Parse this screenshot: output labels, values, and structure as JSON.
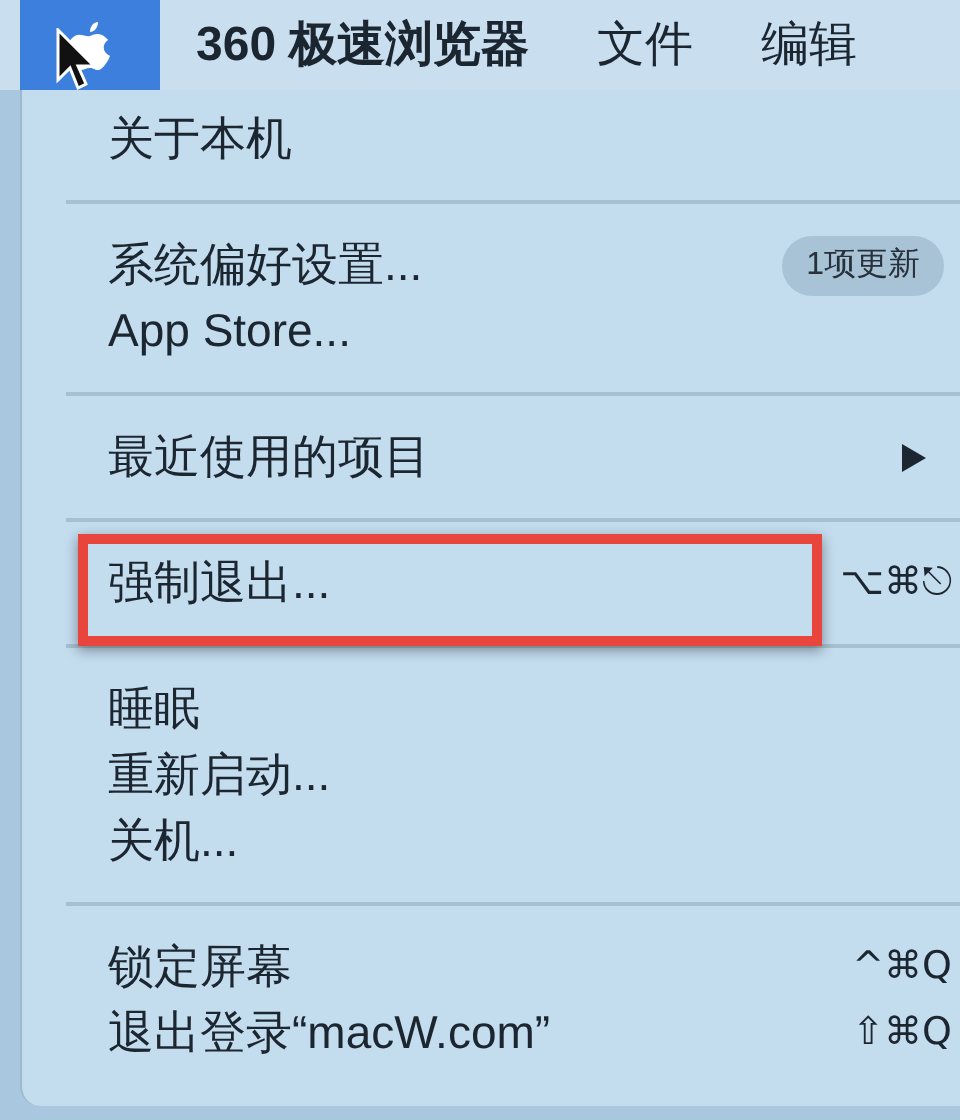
{
  "menu_bar": {
    "items": [
      {
        "label": "360 极速浏览器",
        "bold": true
      },
      {
        "label": "文件",
        "bold": false
      },
      {
        "label": "编辑",
        "bold": false
      }
    ]
  },
  "menu": {
    "sections": [
      [
        {
          "label": "关于本机"
        }
      ],
      [
        {
          "label": "系统偏好设置...",
          "badge": "1项更新"
        },
        {
          "label": "App Store..."
        }
      ],
      [
        {
          "label": "最近使用的项目",
          "submenu": true
        }
      ],
      [
        {
          "label": "强制退出...",
          "shortcut": "⌥⌘⎋",
          "highlighted": true
        }
      ],
      [
        {
          "label": "睡眠"
        },
        {
          "label": "重新启动..."
        },
        {
          "label": "关机..."
        }
      ],
      [
        {
          "label": "锁定屏幕",
          "shortcut": "^⌘Q"
        },
        {
          "label": "退出登录“macW.com”",
          "shortcut": "⇧⌘Q"
        }
      ]
    ]
  }
}
